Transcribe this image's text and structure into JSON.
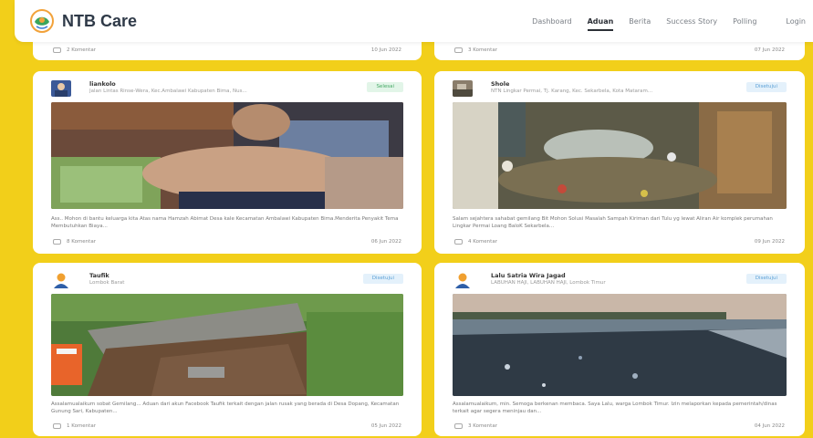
{
  "brand": {
    "name": "NTB Care"
  },
  "nav": {
    "items": [
      {
        "label": "Dashboard",
        "active": false
      },
      {
        "label": "Aduan",
        "active": true
      },
      {
        "label": "Berita",
        "active": false
      },
      {
        "label": "Success Story",
        "active": false
      },
      {
        "label": "Polling",
        "active": false
      },
      {
        "label": "Login",
        "active": false
      }
    ]
  },
  "top_cards": [
    {
      "comments": "2 Komentar",
      "date": "10 Jun 2022"
    },
    {
      "comments": "3 Komentar",
      "date": "07 Jun 2022"
    }
  ],
  "cards": [
    {
      "user": "liankolo",
      "location": "Jalan Lintas Rinse-Wera, Kec.Ambalawi Kabupaten Bima, Nus...",
      "status": "Selesai",
      "status_color": "#45a865",
      "description": "Ass.. Mohon di bantu keluarga kita Atas nama Hamzah Abimat Desa kale Kecamatan Ambalawi Kabupaten Bima.Menderita Penyakit Tema Membutuhkan Biaya...",
      "comments": "8 Komentar",
      "date": "06 Jun 2022"
    },
    {
      "user": "Shole",
      "location": "NTN Lingkar Permai, Tj. Karang, Kec. Sekarbela, Kota Mataram...",
      "status": "Disetujui",
      "status_color": "#5a9fd6",
      "description": "Salam sejahtera sahabat gemilang Bit Mohon Solusi Masalah Sampah Kiriman dari Tulu yg lewat Aliran Air komplek perumahan Lingkar Permai Loang BaloK Sekarbela...",
      "comments": "4 Komentar",
      "date": "09 Jun 2022"
    },
    {
      "user": "Taufik",
      "location": "Lombok Barat",
      "status": "Disetujui",
      "status_color": "#5a9fd6",
      "description": "Assalamualaikum sobat Gemilang... Aduan dari akun Facebook Taufik terkait dengan jalan rusak yang berada di Desa Dopang, Kecamatan Gunung Sari, Kabupaten...",
      "comments": "1 Komentar",
      "date": "05 Jun 2022"
    },
    {
      "user": "Lalu Satria Wira Jagad",
      "location": "LABUHAN HAJI, LABUHAN HAJI, Lombok Timur",
      "status": "Disetujui",
      "status_color": "#5a9fd6",
      "description": "Assalamualaikum, min. Semoga berkenan membaca. Saya Lalu, warga Lombok Timur. Izin melaporkan kepada pemerintah/dinas terkait agar segera meninjau dan...",
      "comments": "3 Komentar",
      "date": "04 Jun 2022"
    }
  ]
}
